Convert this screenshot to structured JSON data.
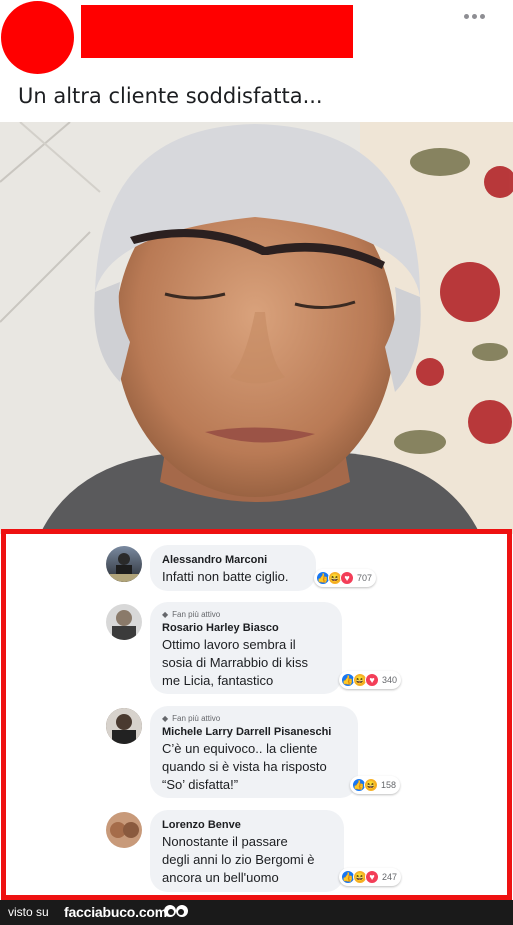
{
  "post": {
    "text": "Un altra cliente soddisfatta...",
    "more_icon": "more-horizontal-icon",
    "redaction_color": "#ff0000"
  },
  "comments": [
    {
      "author": "Alessandro Marconi",
      "text": "Infatti non batte ciglio.",
      "reaction_count": "707",
      "reactions": [
        "like",
        "haha",
        "love"
      ]
    },
    {
      "badge": "Fan più attivo",
      "author": "Rosario Harley Biasco",
      "text": "Ottimo lavoro sembra il\nsosia di Marrabbio di kiss\nme Licia, fantastico",
      "reaction_count": "340",
      "reactions": [
        "like",
        "haha",
        "love"
      ]
    },
    {
      "badge": "Fan più attivo",
      "author": "Michele Larry Darrell Pisaneschi",
      "text": "C’è un equivoco.. la cliente\nquando si è vista ha risposto\n“So’ disfatta!”",
      "reaction_count": "158",
      "reactions": [
        "like",
        "haha"
      ]
    },
    {
      "author": "Lorenzo Benve",
      "text": "Nonostante il passare\ndegli anni lo zio Bergomi è\nancora un bell'uomo",
      "reaction_count": "247",
      "reactions": [
        "like",
        "haha",
        "love"
      ]
    }
  ],
  "footer": {
    "visto_su": "visto su",
    "logo": "facciabuco.com"
  },
  "colors": {
    "comment_frame": "#ee1111",
    "like": "#1877f2",
    "haha": "#f7b125",
    "love": "#f33e58"
  }
}
